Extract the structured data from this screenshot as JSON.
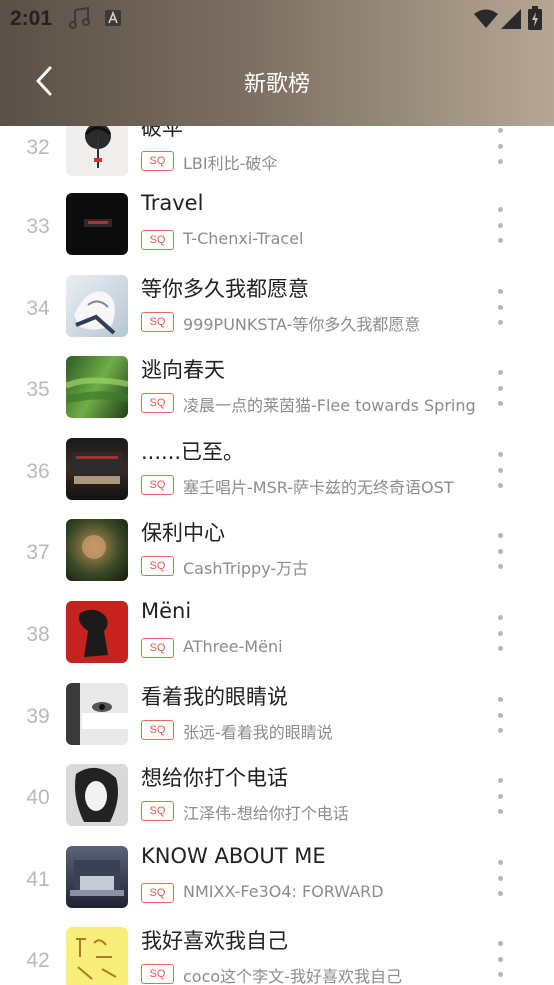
{
  "status_bar": {
    "time": "2:01"
  },
  "header": {
    "title": "新歌榜"
  },
  "badge": "SQ",
  "songs": [
    {
      "rank": "32",
      "title": "破伞",
      "artist": "LBI利比-破伞"
    },
    {
      "rank": "33",
      "title": "Travel",
      "artist": "T-Chenxi-Tracel"
    },
    {
      "rank": "34",
      "title": "等你多久我都愿意",
      "artist": "999PUNKSTA-等你多久我都愿意"
    },
    {
      "rank": "35",
      "title": "逃向春天",
      "artist": "凌晨一点的莱茵猫-Flee towards Spring"
    },
    {
      "rank": "36",
      "title": "......已至。",
      "artist": "塞壬唱片-MSR-萨卡兹的无终奇语OST"
    },
    {
      "rank": "37",
      "title": "保利中心",
      "artist": "CashTrippy-万古"
    },
    {
      "rank": "38",
      "title": "Mëni",
      "artist": "AThree-Mëni"
    },
    {
      "rank": "39",
      "title": "看着我的眼睛说",
      "artist": "张远-看着我的眼睛说"
    },
    {
      "rank": "40",
      "title": "想给你打个电话",
      "artist": "江泽伟-想给你打个电话"
    },
    {
      "rank": "41",
      "title": "KNOW ABOUT ME",
      "artist": "NMIXX-Fe3O4: FORWARD"
    },
    {
      "rank": "42",
      "title": "我好喜欢我自己",
      "artist": "coco这个李文-我好喜欢我自己"
    }
  ]
}
